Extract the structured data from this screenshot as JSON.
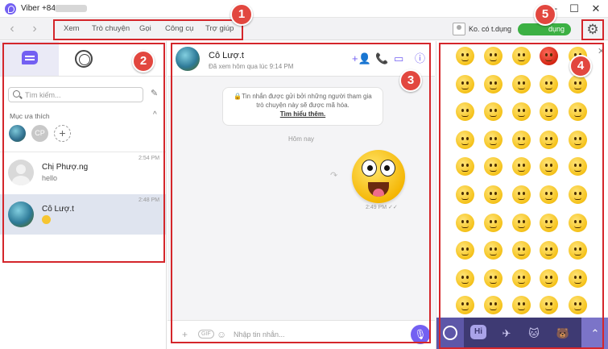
{
  "window": {
    "title": "Viber +849",
    "minimize": "─",
    "maximize": "☐",
    "close": "✕"
  },
  "toolbar": {
    "back": "‹",
    "forward": "›",
    "menu": [
      "Xem",
      "Trò chuyện",
      "Gọi",
      "Công cụ",
      "Trợ giúp"
    ],
    "user_name": "Ko. có t.dụng",
    "status": "dụng",
    "gear": "⚙"
  },
  "sidebar": {
    "search_placeholder": "Tìm kiếm...",
    "compose_icon": "✎",
    "favorites_title": "Mục ưa thích",
    "favorites_chevron": "^",
    "favorites": [
      {
        "type": "photo"
      },
      {
        "type": "initials",
        "initials": "CP"
      },
      {
        "type": "add",
        "glyph": "+"
      }
    ],
    "conversations": [
      {
        "name": "Chị Phượ.ng",
        "message": "hello",
        "time": "2:54 PM",
        "active": false
      },
      {
        "name": "Cô Lượ.t",
        "message": "",
        "time": "2:48 PM",
        "active": true
      }
    ]
  },
  "chat": {
    "contact_name": "Cô Lượ.t",
    "last_seen": "Đã xem hôm qua lúc 9:14 PM",
    "header_icons": [
      "+👤",
      "📞",
      "⊕",
      "▭",
      "ⓘ"
    ],
    "notice_text": "🔒Tin nhắn được gửi bởi những người tham gia trò chuyện này sẽ được mã hóa.",
    "notice_link": "Tìm hiểu thêm.",
    "date_divider": "Hôm nay",
    "share_icon": "↷",
    "message_time": "2:49 PM ✓✓",
    "composer": {
      "plus": "+",
      "gif": "GIF",
      "sticker_icon": "☺",
      "placeholder": "Nhập tin nhắn...",
      "mic": "🎙"
    }
  },
  "emoji_panel": {
    "close": "✕",
    "tabs": [
      {
        "name": "emoji",
        "label": ""
      },
      {
        "name": "hi-sticker",
        "label": "Hi"
      },
      {
        "name": "sticker-2",
        "label": "✈"
      },
      {
        "name": "sticker-3",
        "label": "🐱"
      },
      {
        "name": "sticker-4",
        "label": "🐻"
      },
      {
        "name": "expand",
        "label": "⌃"
      }
    ]
  },
  "annotations": [
    "1",
    "2",
    "3",
    "4",
    "5"
  ],
  "colors": {
    "viber_purple": "#7360f2",
    "annotation_red": "#d4262b",
    "status_green": "#3cb043",
    "emoji_tabbar": "#3e3a73"
  }
}
